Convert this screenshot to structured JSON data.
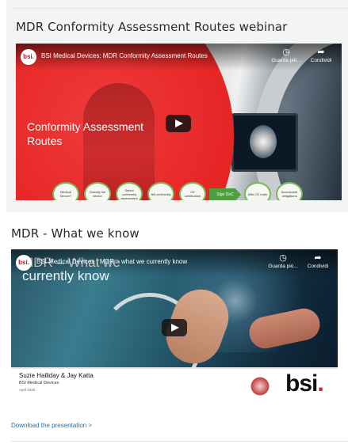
{
  "section1": {
    "title": "MDR Conformity Assessment Routes webinar",
    "video": {
      "channel_logo": "bsi.",
      "title": "BSI Medical Devices: MDR Conformity Assessment Routes",
      "overlay_title": "Conformity Assessment Routes",
      "action_watch_later": "Guarda più...",
      "action_share": "Condividi",
      "flow_steps": [
        "Medical Device?",
        "Classify the device",
        "Select conformity assessment",
        "NB conformity",
        "CE certification",
        "Sign DoC",
        "Affix CE mark",
        "Accessorial obligations"
      ]
    }
  },
  "section2": {
    "title": "MDR - What we know",
    "video": {
      "channel_logo": "bsi.",
      "title": "BSI Medical Devices | MDR – what we currently know",
      "slide_heading": "MDR – What we currently know",
      "action_watch_later": "Guarda più...",
      "action_share": "Condividi",
      "presenters": "Suzie Halliday & Jay Katta",
      "affiliation": "BSI Medical Devices",
      "date": "April 2020",
      "brand": "bsi",
      "brand_dot": "."
    },
    "download_link": "Download the presentation >"
  },
  "icons": {
    "watch_later": "clock-icon",
    "share": "share-arrow-icon",
    "play": "play-icon"
  },
  "colors": {
    "accent_red": "#e3201f",
    "link_blue": "#1f6fb3",
    "flow_green": "#4e9f3d"
  }
}
